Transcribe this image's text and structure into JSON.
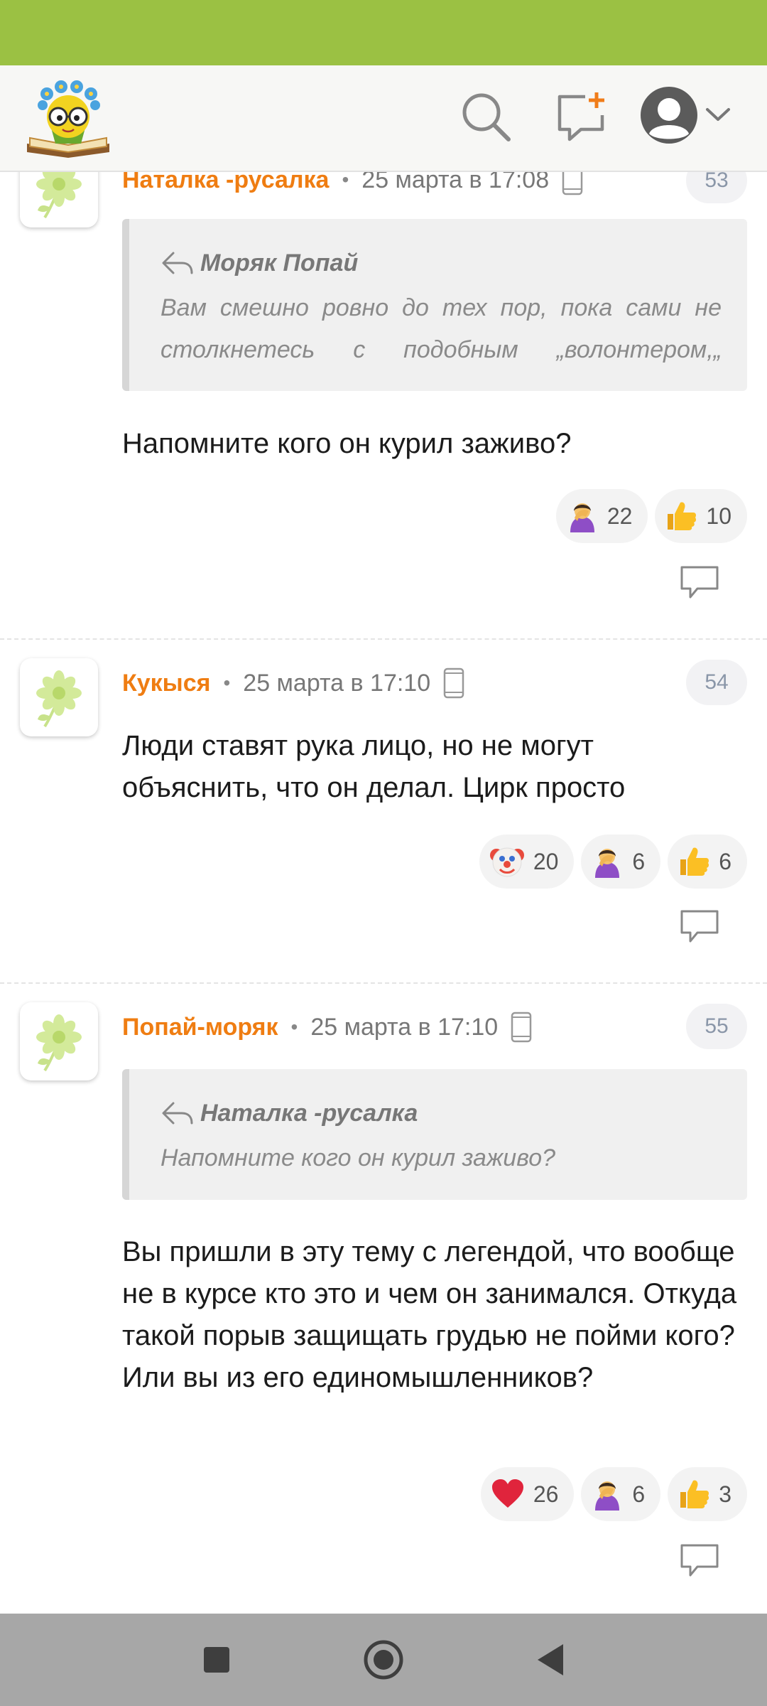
{
  "header": {
    "logo_icon": "daisy-glasses-book-logo",
    "icons": [
      "search-icon",
      "new-post-icon",
      "user-avatar-icon",
      "chevron-down-icon"
    ]
  },
  "colors": {
    "status_bar": "#9bc143",
    "author": "#ef7d12",
    "nav_bar": "#a7a7a7"
  },
  "comments": [
    {
      "author": "Наталка -русалка",
      "date": "25 марта в 17:08",
      "number": "53",
      "quote": {
        "author": "Моряк Попай",
        "text": "Вам смешно ровно до тех пор, пока сами не столкнетесь с подобным „волонтером,„ который курил заживо"
      },
      "text": "Напомните кого он курил заживо?",
      "reactions": [
        {
          "icon": "facepalm-emoji",
          "count": "22"
        },
        {
          "icon": "thumbs-up-emoji",
          "count": "10"
        }
      ]
    },
    {
      "author": "Кукыся",
      "date": "25 марта в 17:10",
      "number": "54",
      "text": "Люди ставят рука лицо, но не могут объяснить, что он делал. Цирк просто",
      "reactions": [
        {
          "icon": "clown-emoji",
          "count": "20"
        },
        {
          "icon": "facepalm-emoji",
          "count": "6"
        },
        {
          "icon": "thumbs-up-emoji",
          "count": "6"
        }
      ]
    },
    {
      "author": "Попай-моряк",
      "date": "25 марта в 17:10",
      "number": "55",
      "quote": {
        "author": "Наталка -русалка",
        "text": "Напомните кого он курил заживо?"
      },
      "text": "Вы пришли в эту тему с легендой, что вообще не в курсе кто это и чем он занимался. Откуда такой порыв защищать грудью не пойми кого? Или вы из его единомышленников?",
      "reactions": [
        {
          "icon": "heart-emoji",
          "count": "26"
        },
        {
          "icon": "facepalm-emoji",
          "count": "6"
        },
        {
          "icon": "thumbs-up-emoji",
          "count": "3"
        }
      ]
    }
  ],
  "nav": [
    "recents-button",
    "home-button",
    "back-button"
  ]
}
